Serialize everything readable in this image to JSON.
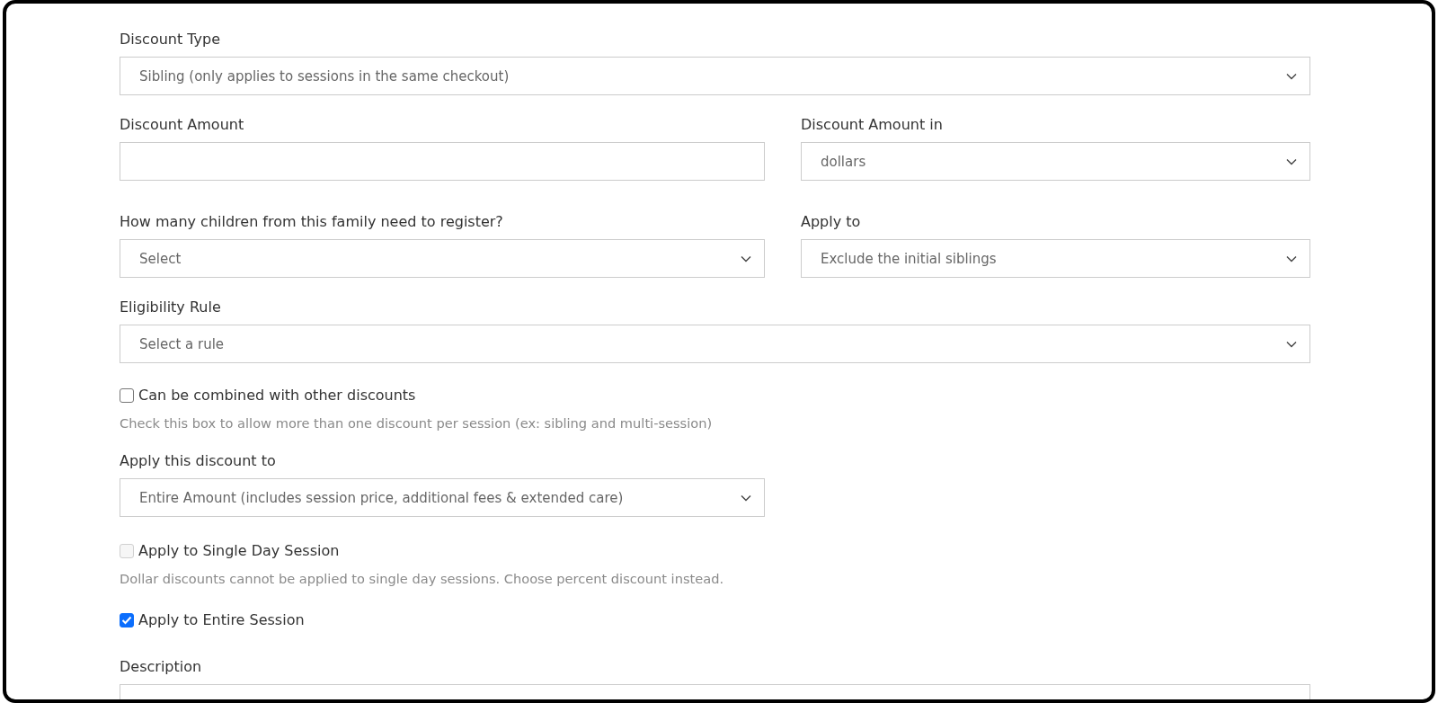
{
  "form": {
    "fields": [
      {
        "kind": "select",
        "label": "Discount Type",
        "value": "Sibling (only applies to sessions in the same checkout)"
      },
      {
        "kind": "input",
        "label": "Discount Amount"
      },
      {
        "kind": "select",
        "label": "Discount Amount in",
        "value": "dollars"
      },
      {
        "kind": "select",
        "label": "How many children from this family need to register?",
        "value": "Select"
      },
      {
        "kind": "select",
        "label": "Apply to",
        "value": "Exclude the initial siblings"
      },
      {
        "kind": "select",
        "label": "Eligibility Rule",
        "value": "Select a rule"
      },
      {
        "kind": "checkbox",
        "label": "Can be combined with other discounts",
        "checked": false,
        "disabled": false,
        "hint": "Check this box to allow more than one discount per session (ex: sibling and multi-session)"
      },
      {
        "kind": "select",
        "label": "Apply this discount to",
        "value": "Entire Amount (includes session price, additional fees & extended care)"
      },
      {
        "kind": "checkbox",
        "label": "Apply to Single Day Session",
        "checked": false,
        "disabled": true,
        "hint": "Dollar discounts cannot be applied to single day sessions. Choose percent discount instead."
      },
      {
        "kind": "checkbox",
        "label": "Apply to Entire Session",
        "checked": true,
        "disabled": false
      },
      {
        "kind": "textarea",
        "label": "Description"
      }
    ]
  }
}
